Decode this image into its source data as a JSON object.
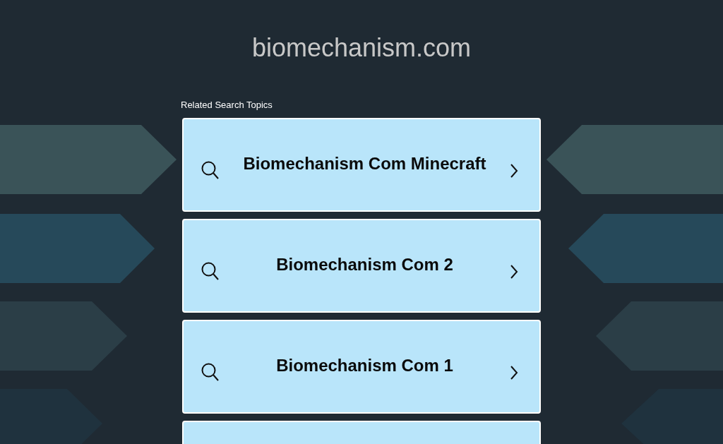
{
  "site_title": "biomechanism.com",
  "section_heading": "Related Search Topics",
  "topics": [
    {
      "label": "Biomechanism Com Minecraft"
    },
    {
      "label": "Biomechanism Com 2"
    },
    {
      "label": "Biomechanism Com 1"
    },
    {
      "cut_off": true
    }
  ]
}
